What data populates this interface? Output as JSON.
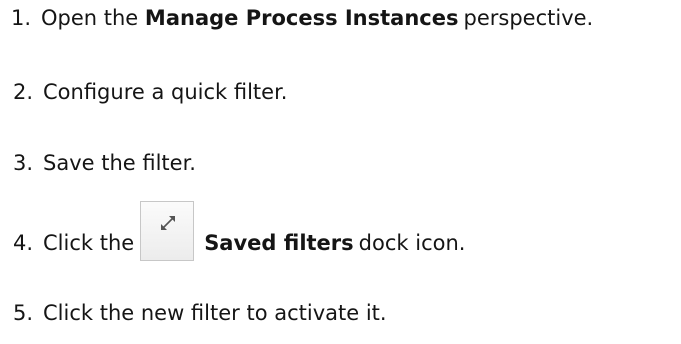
{
  "steps": [
    {
      "number": "1.",
      "before": "Open the",
      "bold": "Manage Process Instances",
      "after": "perspective."
    },
    {
      "number": "2.",
      "text": "Configure a quick filter."
    },
    {
      "number": "3.",
      "text": "Save the filter."
    },
    {
      "number": "4.",
      "before": "Click the",
      "icon": "expand-arrows-icon",
      "bold": "Saved filters",
      "after": "dock icon."
    },
    {
      "number": "5.",
      "text": "Click the new filter to activate it."
    }
  ]
}
